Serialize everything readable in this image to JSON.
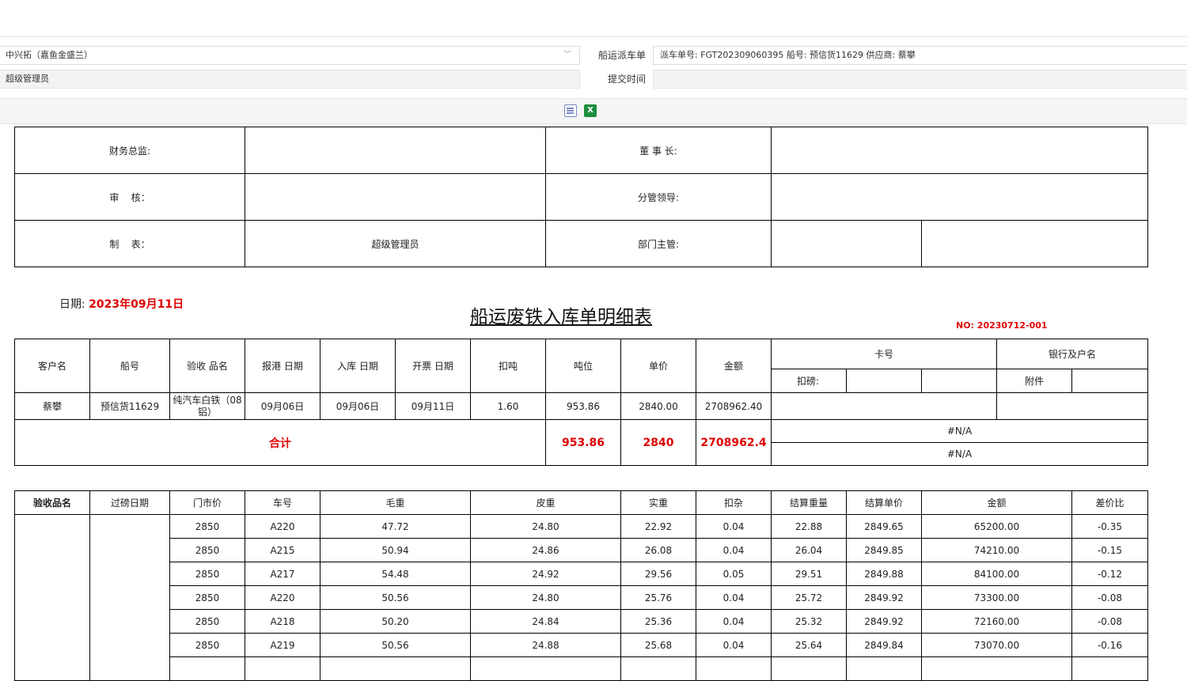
{
  "form": {
    "company_value": "中兴拓（嘉鱼金盛兰）",
    "creator_value": "超级管理员",
    "dispatch_label": "船运派车单",
    "dispatch_value": "派车单号: FGT202309060395  船号: 预信货11629  供应商: 蔡攀",
    "submit_time_label": "提交时间",
    "submit_time_value": ""
  },
  "toolbar": {
    "print_icon": "print-icon",
    "excel_icon": "excel-icon",
    "excel_glyph": "X"
  },
  "approval": {
    "finance_director_label": "财务总监:",
    "chairman_label": "董 事 长:",
    "review_label": "审    核：",
    "division_leader_label": "分管领导:",
    "preparer_label": "制    表：",
    "preparer_value": "超级管理员",
    "dept_head_label": "部门主管:"
  },
  "report": {
    "date_label": "日期:",
    "date_value": "2023年09月11日",
    "title": "船运废铁入库单明细表",
    "no": "NO: 20230712-001"
  },
  "summary": {
    "headers": [
      "客户名",
      "船号",
      "验收 品名",
      "报港 日期",
      "入库 日期",
      "开票 日期",
      "扣吨",
      "吨位",
      "单价",
      "金额"
    ],
    "card_no_label": "卡号",
    "bank_label": "银行及户名",
    "deduct_label": "扣磅:",
    "attachment_label": "附件",
    "row": [
      "蔡攀",
      "预信货11629",
      "纯汽车白铁（08铝）",
      "09月06日",
      "09月06日",
      "09月11日",
      "1.60",
      "953.86",
      "2840.00",
      "2708962.40"
    ],
    "total_label": "合计",
    "total_tonnage": "953.86",
    "total_price": "2840",
    "total_amount": "2708962.4",
    "na1": "#N/A",
    "na2": "#N/A"
  },
  "detail": {
    "headers": [
      "验收品名",
      "过磅日期",
      "门市价",
      "车号",
      "毛重",
      "皮重",
      "实重",
      "扣杂",
      "结算重量",
      "结算单价",
      "金额",
      "差价比"
    ],
    "rows": [
      [
        "2850",
        "A220",
        "47.72",
        "24.80",
        "22.92",
        "0.04",
        "22.88",
        "2849.65",
        "65200.00",
        "-0.35"
      ],
      [
        "2850",
        "A215",
        "50.94",
        "24.86",
        "26.08",
        "0.04",
        "26.04",
        "2849.85",
        "74210.00",
        "-0.15"
      ],
      [
        "2850",
        "A217",
        "54.48",
        "24.92",
        "29.56",
        "0.05",
        "29.51",
        "2849.88",
        "84100.00",
        "-0.12"
      ],
      [
        "2850",
        "A220",
        "50.56",
        "24.80",
        "25.76",
        "0.04",
        "25.72",
        "2849.92",
        "73300.00",
        "-0.08"
      ],
      [
        "2850",
        "A218",
        "50.20",
        "24.84",
        "25.36",
        "0.04",
        "25.32",
        "2849.92",
        "72160.00",
        "-0.08"
      ],
      [
        "2850",
        "A219",
        "50.56",
        "24.88",
        "25.68",
        "0.04",
        "25.64",
        "2849.84",
        "73070.00",
        "-0.16"
      ]
    ]
  }
}
